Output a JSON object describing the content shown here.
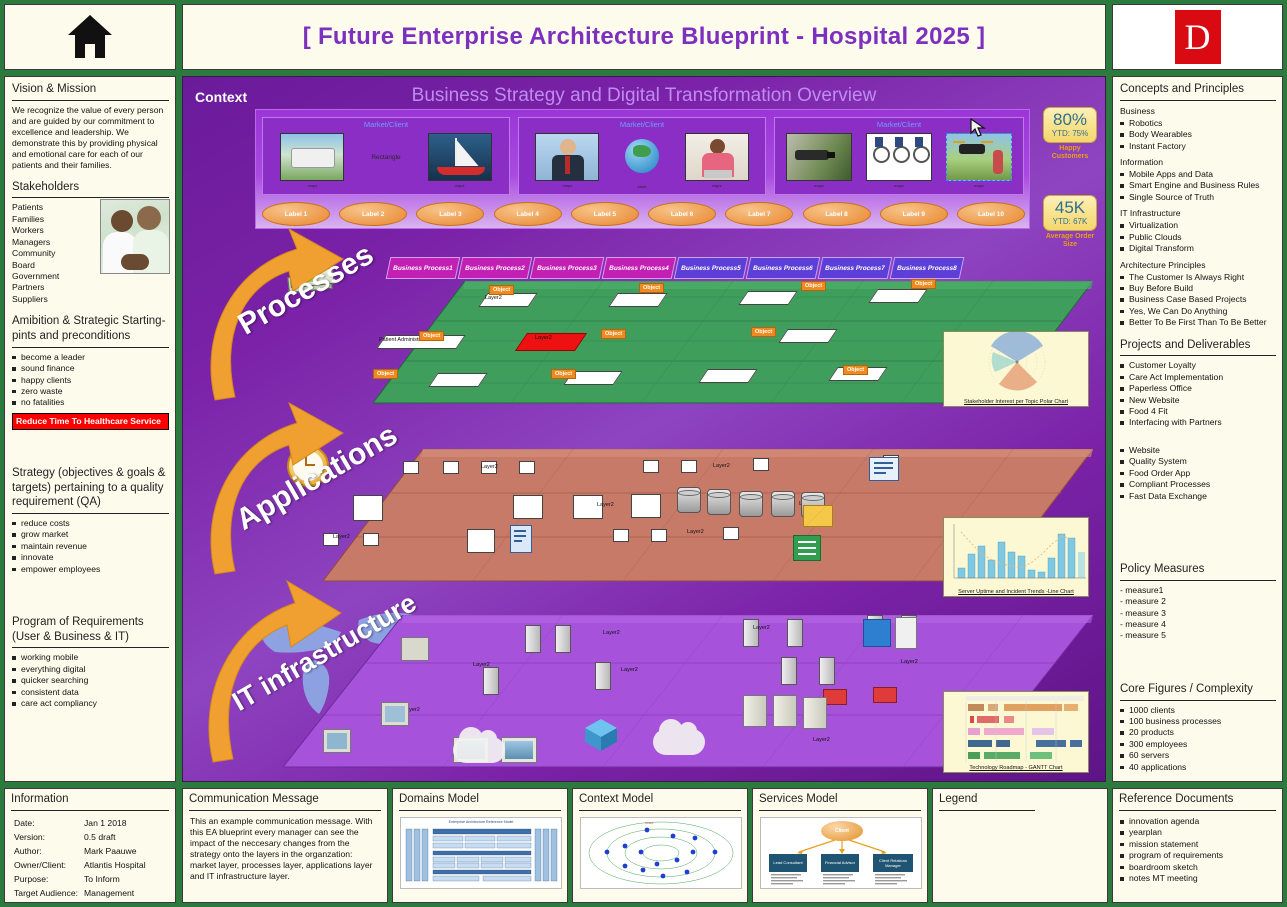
{
  "header": {
    "home_icon": "home-icon",
    "title": "[ Future Enterprise Architecture Blueprint - Hospital 2025 ]",
    "logo_letter": "D",
    "logo_color": "#d90a12",
    "title_color": "#7d2fbe"
  },
  "left": {
    "vision": {
      "title": "Vision & Mission",
      "text": "We recognize the value of every person and are guided by our commitment to excellence and leadership. We demonstrate this by providing physical and emotional care for each of our patients and their families."
    },
    "stakeholders": {
      "title": "Stakeholders",
      "items": [
        "Patients",
        "Families",
        "Workers",
        "Managers",
        "Community",
        "Board",
        "Government",
        "Partners",
        "Suppliers"
      ],
      "image_caption": "stakeholders-photo"
    },
    "ambition": {
      "title": "Amibition & Strategic Starting-pints and preconditions",
      "items": [
        "become a leader",
        "sound finance",
        "happy clients",
        "zero waste",
        "no fatalities"
      ],
      "banner": "Reduce Time To Healthcare Service",
      "banner_bg": "#ff0000"
    },
    "strategy": {
      "title": "Strategy (objectives & goals & targets) pertaining to a quality requirement (QA)",
      "items": [
        "reduce costs",
        "grow market",
        "maintain revenue",
        "innovate",
        "empower employees"
      ]
    },
    "requirements": {
      "title": "Program of Requirements (User & Business & IT)",
      "items": [
        "working mobile",
        "everything digital",
        "quicker searching",
        "consistent data",
        "care act compliancy"
      ]
    }
  },
  "right": {
    "concepts": {
      "title": "Concepts and Principles",
      "groups": [
        {
          "label": "Business",
          "items": [
            "Robotics",
            "Body Wearables",
            "Instant Factory"
          ]
        },
        {
          "label": "Information",
          "items": [
            "Mobile Apps and Data",
            "Smart Engine and Business Rules",
            "Single Source of Truth"
          ]
        },
        {
          "label": "IT Infrastructure",
          "items": [
            "Virtualization",
            "Public Clouds",
            "Digital Transform"
          ]
        },
        {
          "label": "Architecture Principles",
          "items": [
            "The Customer Is Always Right",
            "Buy Before Build",
            "Business Case Based Projects",
            "Yes, We Can Do Anything",
            "Better To Be First Than To Be Better"
          ]
        }
      ]
    },
    "projects": {
      "title": "Projects and Deliverables",
      "items": [
        "Customer Loyalty",
        "Care Act Implementation",
        "Paperless Office",
        "New Website",
        "Food 4 Fit",
        "Interfacing with Partners"
      ],
      "items2": [
        "Website",
        "Quality System",
        "Food Order App",
        "Compliant Processes",
        "Fast Data Exchange"
      ]
    },
    "policy": {
      "title": "Policy Measures",
      "items": [
        "- measure1",
        "- measure 2",
        "- measure 3",
        "- measure 4",
        "- measure 5"
      ]
    },
    "core": {
      "title": "Core Figures / Complexity",
      "items": [
        "1000 clients",
        "100 business processes",
        "20 products",
        "300 employees",
        "60 servers",
        "40 applications"
      ]
    }
  },
  "canvas": {
    "context_label": "Context",
    "overview_title": "Business Strategy and Digital Transformation Overview",
    "markets": [
      {
        "caption": "Market/Client",
        "images": [
          "caravan-photo",
          "rectangle-text",
          "sailboat-photo"
        ],
        "image_captions": [
          "maps",
          "maps",
          "maps"
        ],
        "middle_text": "Rectangle"
      },
      {
        "caption": "Market/Client",
        "images": [
          "businessman-phone-photo",
          "globe-icon",
          "woman-laptop-photo"
        ],
        "image_captions": [
          "maps",
          "pasir",
          "maps"
        ]
      },
      {
        "caption": "Market/Client",
        "images": [
          "security-camera-photo",
          "wheelchair-photo",
          "drone-photo"
        ],
        "image_captions": [
          "maps",
          "maps",
          "maps"
        ]
      }
    ],
    "labels": [
      "Label 1",
      "Label 2",
      "Label 3",
      "Label 4",
      "Label 5",
      "Label 6",
      "Label 7",
      "Label 8",
      "Label 9",
      "Label 10"
    ],
    "kpis": [
      {
        "value": "80%",
        "ytd": "YTD: 75%",
        "caption": "Happy Customers"
      },
      {
        "value": "45K",
        "ytd": "YTD: 67K",
        "caption": "Average Order Size"
      }
    ],
    "business_processes": [
      {
        "label": "Business Process1",
        "color": "#c21fb3"
      },
      {
        "label": "Business Process2",
        "color": "#c21fb3"
      },
      {
        "label": "Business Process3",
        "color": "#c21fb3"
      },
      {
        "label": "Business Process4",
        "color": "#c21fb3"
      },
      {
        "label": "Business Process5",
        "color": "#5b3fd6"
      },
      {
        "label": "Business Process6",
        "color": "#5b3fd6"
      },
      {
        "label": "Business Process7",
        "color": "#5b3fd6"
      },
      {
        "label": "Business Process8",
        "color": "#5b3fd6"
      }
    ],
    "layers": [
      {
        "name": "Processes",
        "color": "#3f9e5b",
        "node_label": "Layer2",
        "highlight_node": "Layer2",
        "special_node": "Patient Administration",
        "tag": "Object"
      },
      {
        "name": "Applications",
        "color": "#c87a68",
        "node_label": "Layer2"
      },
      {
        "name": "IT infrastructure",
        "color": "#9b4fd0",
        "node_label": "Layer2"
      }
    ],
    "thumbnails": [
      {
        "caption": "Stakeholder Interest per Topic Polar Chart",
        "type": "polar"
      },
      {
        "caption": "Server Uptime and Incident Trends -Line Chart",
        "type": "bar-line"
      },
      {
        "caption": "Technology Roadmap - GANTT Chart",
        "type": "gantt"
      }
    ]
  },
  "bottom": {
    "information": {
      "title": "Information",
      "rows": [
        {
          "key": "Date:",
          "value": "Jan 1 2018"
        },
        {
          "key": "Version:",
          "value": "0.5 draft"
        },
        {
          "key": "Author:",
          "value": "Mark Paauwe"
        },
        {
          "key": "Owner/Client:",
          "value": "Atlantis Hospital"
        },
        {
          "key": "Purpose:",
          "value": "To Inform"
        },
        {
          "key": "Target Audience:",
          "value": "Management"
        }
      ]
    },
    "communication": {
      "title": "Communication Message",
      "text": "This an example communication message. With this EA blueprint every manager can see the impact of the neccesary changes from the strategy onto the layers in the organzation: market layer, processes layer, applications layer and IT infrastructure layer."
    },
    "domains": {
      "title": "Domains Model",
      "image_title": "Enterprise Architecture Reference Model"
    },
    "context": {
      "title": "Context Model"
    },
    "services": {
      "title": "Services Model",
      "center": "Client",
      "boxes": [
        "Lead Consultant",
        "Financial Advisor",
        "Client Relations Manager"
      ]
    },
    "legend": {
      "title": "Legend"
    },
    "reference": {
      "title": "Reference Documents",
      "items": [
        "innovation agenda",
        "yearplan",
        "mission statement",
        "program of requirements",
        "boardroom sketch",
        "notes MT meeting"
      ]
    }
  }
}
